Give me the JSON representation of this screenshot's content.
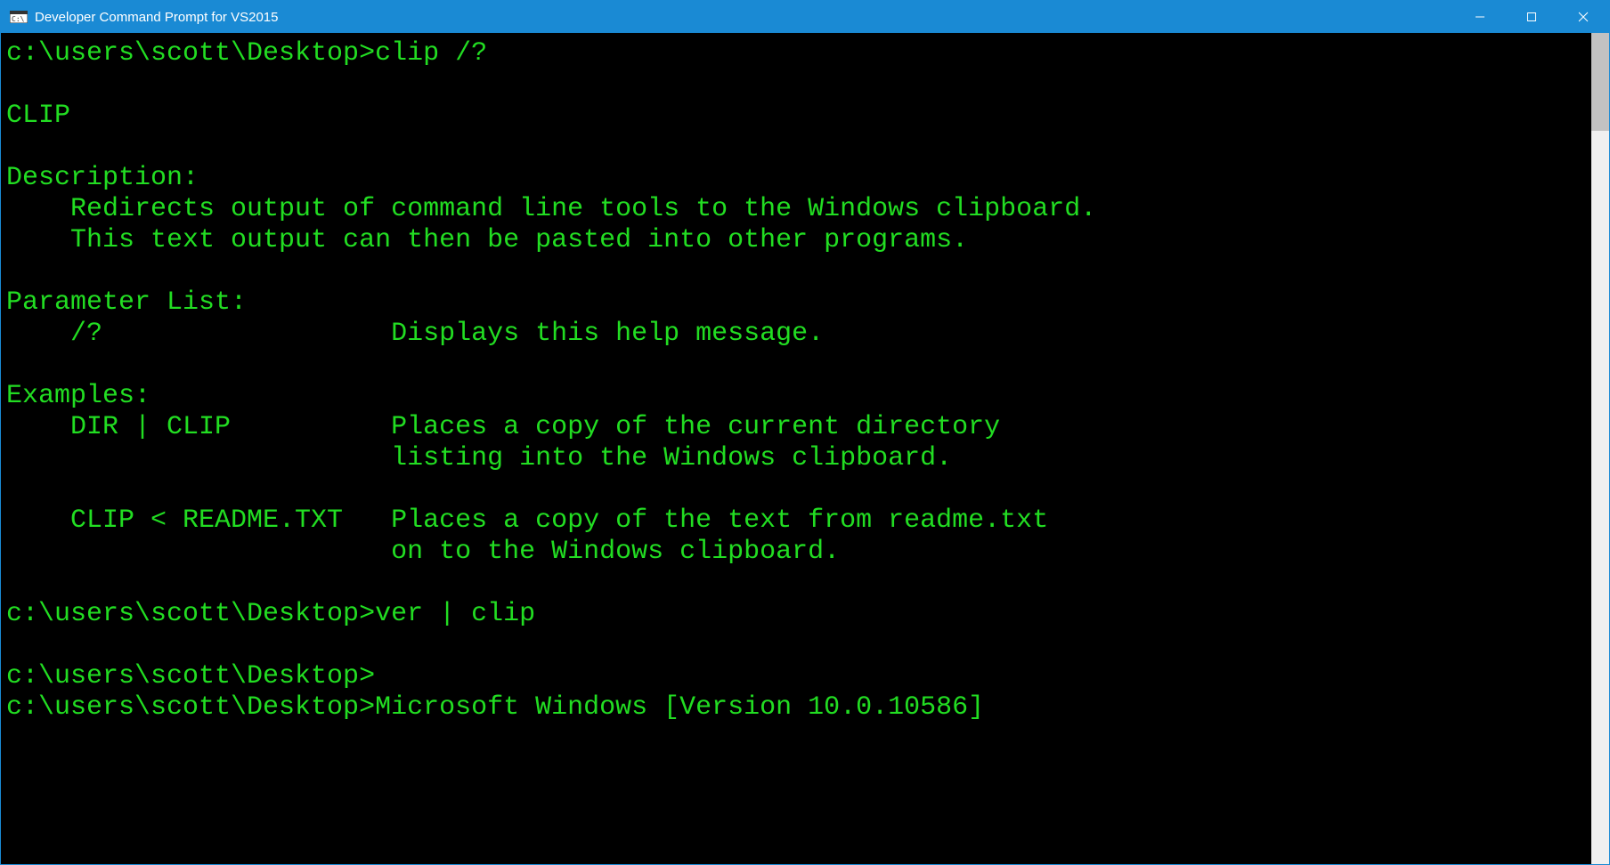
{
  "window": {
    "title": "Developer Command Prompt for VS2015"
  },
  "terminal": {
    "lines": [
      "c:\\users\\scott\\Desktop>clip /?",
      "",
      "CLIP",
      "",
      "Description:",
      "    Redirects output of command line tools to the Windows clipboard.",
      "    This text output can then be pasted into other programs.",
      "",
      "Parameter List:",
      "    /?                  Displays this help message.",
      "",
      "Examples:",
      "    DIR | CLIP          Places a copy of the current directory",
      "                        listing into the Windows clipboard.",
      "",
      "    CLIP < README.TXT   Places a copy of the text from readme.txt",
      "                        on to the Windows clipboard.",
      "",
      "c:\\users\\scott\\Desktop>ver | clip",
      "",
      "c:\\users\\scott\\Desktop>",
      "c:\\users\\scott\\Desktop>Microsoft Windows [Version 10.0.10586]"
    ]
  }
}
